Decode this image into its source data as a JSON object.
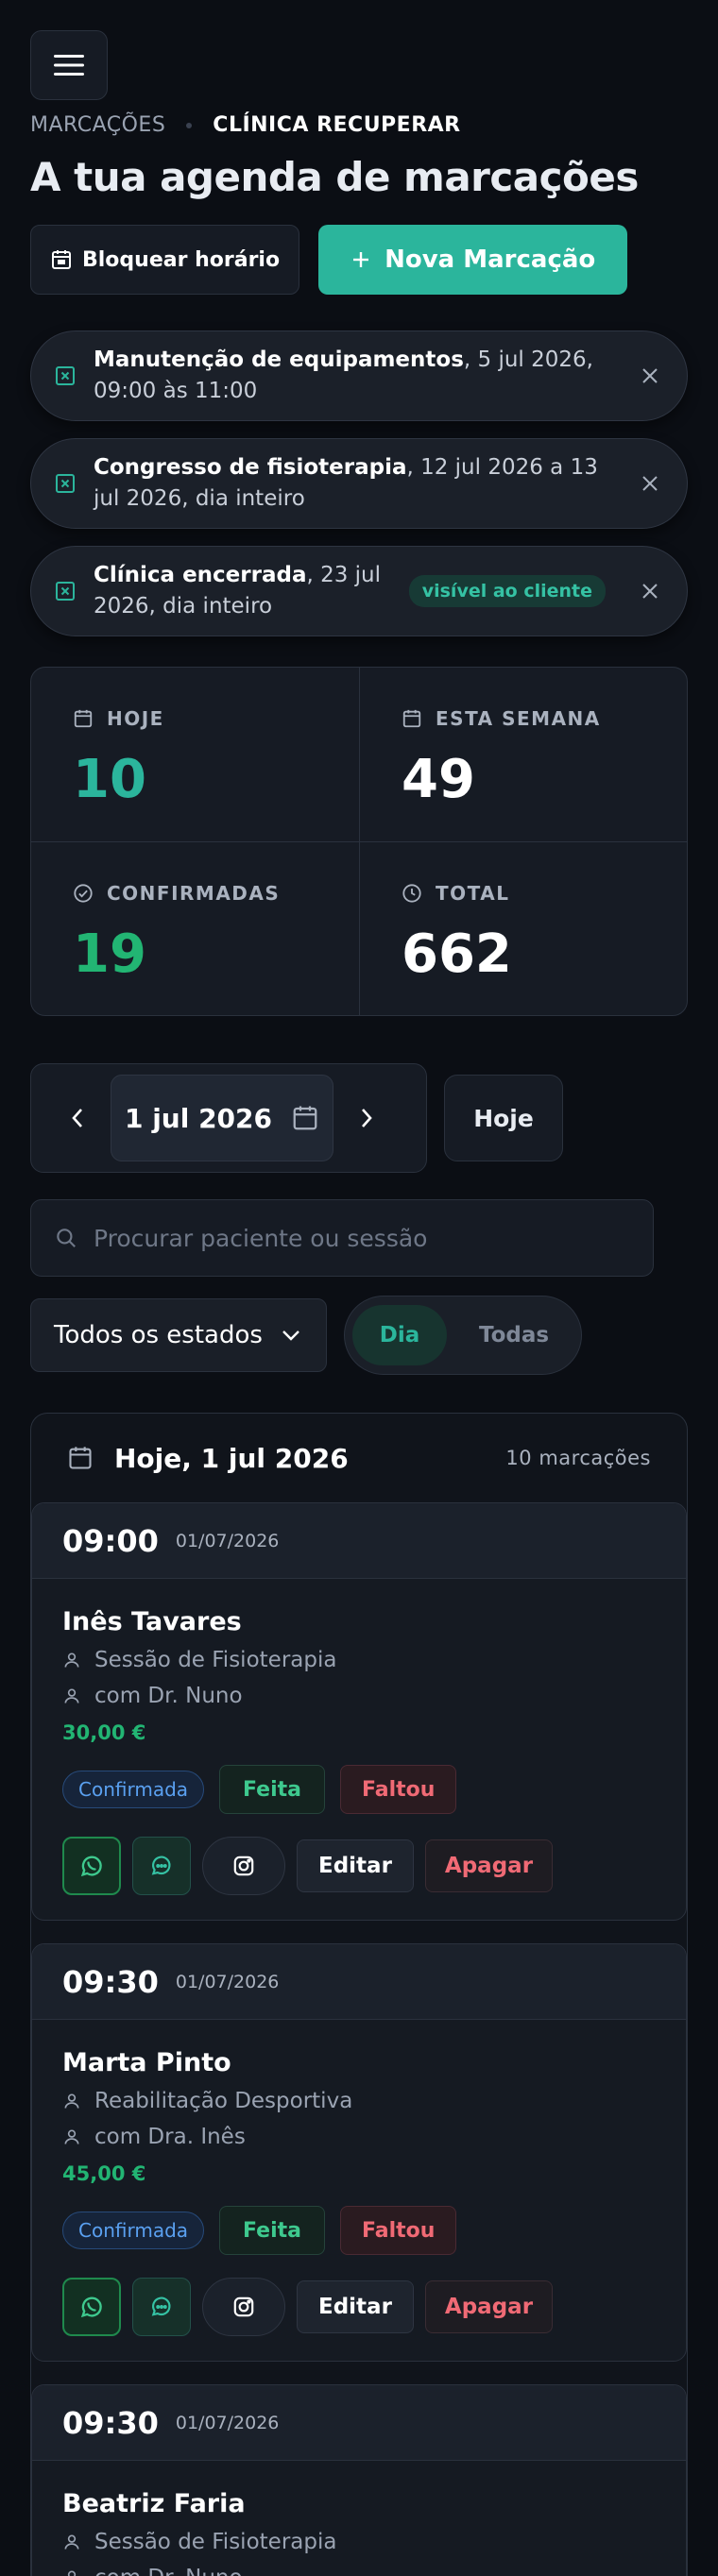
{
  "header": {
    "menu_icon": "hamburger-icon",
    "breadcrumb": [
      "MARCAÇÕES",
      "CLÍNICA RECUPERAR"
    ],
    "title": "A tua agenda de marcações"
  },
  "actions": {
    "block_label": "Bloquear horário",
    "new_label": "Nova Marcação",
    "new_icon": "plus-icon",
    "block_icon": "calendar-block-icon"
  },
  "blocks": [
    {
      "title": "Manutenção de equipamentos",
      "detail": ", 5 jul 2026, 09:00 às 11:00",
      "badge": ""
    },
    {
      "title": "Congresso de fisioterapia",
      "detail": ", 12 jul 2026 a 13 jul 2026, dia inteiro",
      "badge": ""
    },
    {
      "title": "Clínica encerrada",
      "detail": ", 23 jul 2026, dia inteiro",
      "badge": "visível ao cliente"
    }
  ],
  "stats": [
    {
      "label": "HOJE",
      "value": "10",
      "icon": "calendar-icon",
      "color": "#2bb59c"
    },
    {
      "label": "ESTA SEMANA",
      "value": "49",
      "icon": "calendar-icon",
      "color": "#ffffff"
    },
    {
      "label": "CONFIRMADAS",
      "value": "19",
      "icon": "check-circle-icon",
      "color": "#22b573"
    },
    {
      "label": "TOTAL",
      "value": "662",
      "icon": "clock-icon",
      "color": "#ffffff"
    }
  ],
  "date_nav": {
    "current": "1 jul 2026",
    "today_label": "Hoje"
  },
  "search": {
    "placeholder": "Procurar paciente ou sessão",
    "value": ""
  },
  "filters": {
    "status_selected": "Todos os estados",
    "view_options": [
      "Dia",
      "Todas"
    ],
    "view_active": "Dia"
  },
  "day": {
    "title": "Hoje, 1 jul 2026",
    "count": "10 marcações"
  },
  "appointments": [
    {
      "time": "09:00",
      "date": "01/07/2026",
      "name": "Inês Tavares",
      "service": "Sessão de Fisioterapia",
      "therapist": "com Dr. Nuno",
      "price": "30,00 €",
      "status": "Confirmada"
    },
    {
      "time": "09:30",
      "date": "01/07/2026",
      "name": "Marta Pinto",
      "service": "Reabilitação Desportiva",
      "therapist": "com Dra. Inês",
      "price": "45,00 €",
      "status": "Confirmada"
    },
    {
      "time": "09:30",
      "date": "01/07/2026",
      "name": "Beatriz Faria",
      "service": "Sessão de Fisioterapia",
      "therapist": "com Dr. Nuno",
      "price": "",
      "status": ""
    }
  ],
  "appointment_actions": {
    "done_label": "Feita",
    "missed_label": "Faltou",
    "edit_label": "Editar",
    "delete_label": "Apagar"
  },
  "colors": {
    "accent": "#2bb59c",
    "success": "#22b573",
    "danger": "#f06a75",
    "info": "#5aa0f0",
    "background": "#0b0e14"
  }
}
